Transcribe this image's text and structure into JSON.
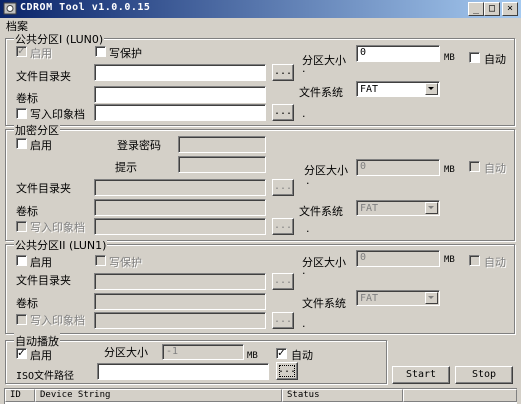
{
  "window": {
    "title": "CDROM Tool v1.0.0.15",
    "min": "_",
    "max": "□",
    "close": "×"
  },
  "menu": {
    "archive": "档案"
  },
  "common": {
    "browse": "...",
    "dot": "."
  },
  "public1": {
    "legend": "公共分区I (LUN0)",
    "enable": "启用",
    "enable_checked": "✓",
    "write_protect": "写保护",
    "partition_size_label": "分区大小",
    "partition_size": "0",
    "unit": "MB",
    "auto": "自动",
    "folder_label": "文件目录夹",
    "folder": "",
    "volume_label": "卷标",
    "volume": "",
    "write_image": "写入印象档",
    "fs_label": "文件系统",
    "fs": "FAT"
  },
  "encrypted": {
    "legend": "加密分区",
    "enable": "启用",
    "password_label": "登录密码",
    "password": "",
    "hint_label": "提示",
    "hint": "",
    "partition_size_label": "分区大小",
    "partition_size": "0",
    "unit": "MB",
    "auto": "自动",
    "folder_label": "文件目录夹",
    "folder": "",
    "volume_label": "卷标",
    "volume": "",
    "write_image": "写入印象档",
    "fs_label": "文件系统",
    "fs": "FAT"
  },
  "public2": {
    "legend": "公共分区II (LUN1)",
    "enable": "启用",
    "write_protect": "写保护",
    "partition_size_label": "分区大小",
    "partition_size": "0",
    "unit": "MB",
    "auto": "自动",
    "folder_label": "文件目录夹",
    "folder": "",
    "volume_label": "卷标",
    "volume": "",
    "write_image": "写入印象档",
    "fs_label": "文件系统",
    "fs": "FAT"
  },
  "autoplay": {
    "legend": "自动播放",
    "enable": "启用",
    "enable_checked": "✓",
    "partition_size_label": "分区大小",
    "partition_size": "-1",
    "unit": "MB",
    "auto": "自动",
    "auto_checked": "✓",
    "iso_label": "ISO文件路径",
    "iso": ""
  },
  "actions": {
    "start": "Start",
    "stop": "Stop"
  },
  "list": {
    "columns": [
      "ID",
      "Device String",
      "Status"
    ]
  }
}
